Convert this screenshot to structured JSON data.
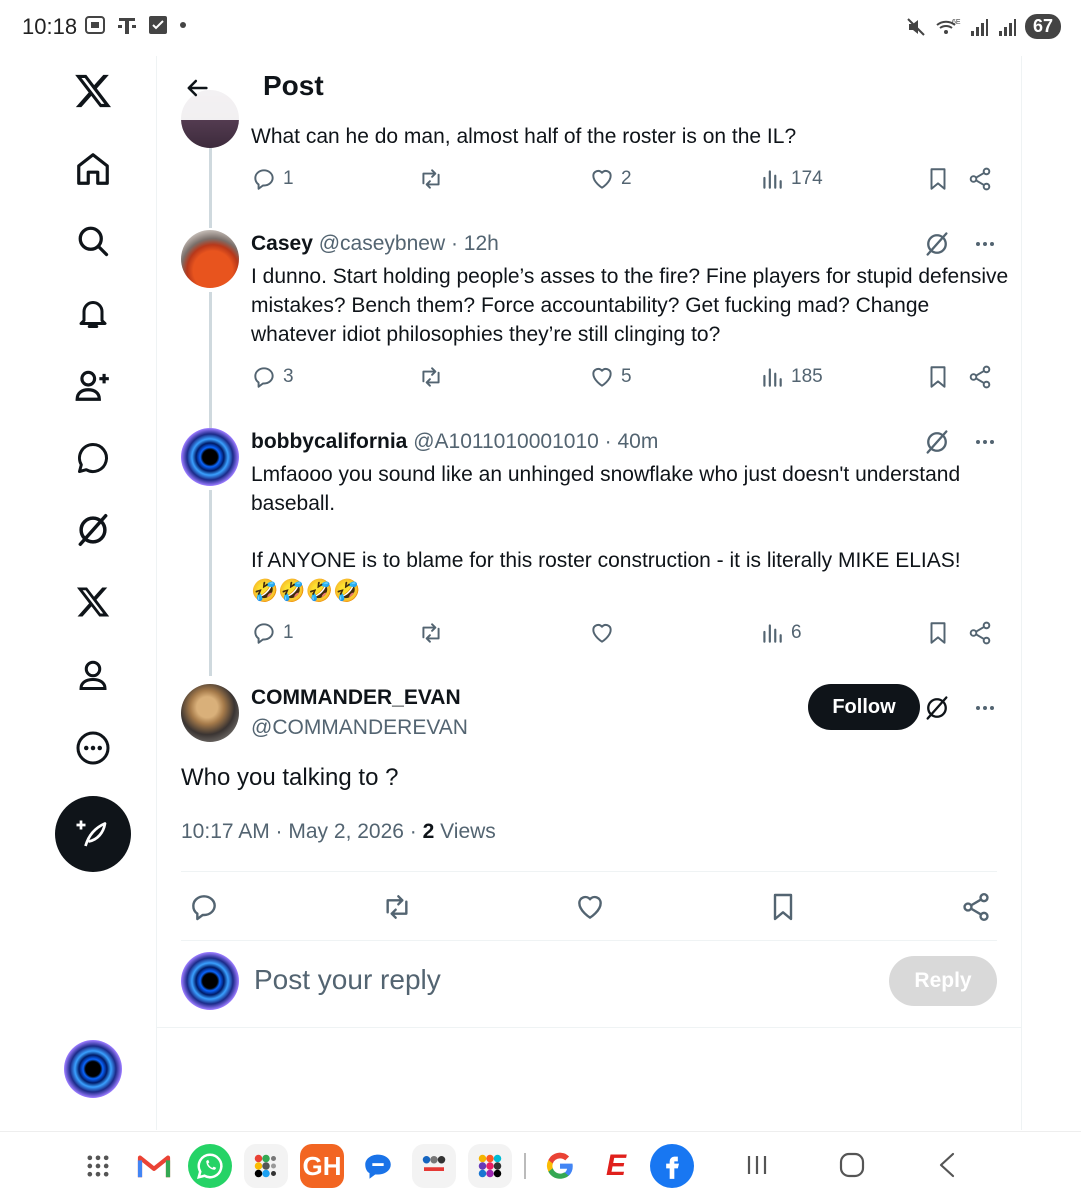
{
  "status_bar": {
    "time": "10:18",
    "battery": "67",
    "left_icons": [
      "screenshot-icon",
      "tmobile-icon",
      "checkbox-icon",
      "dot-icon"
    ],
    "right_icons": [
      "mute-icon",
      "wifi-6e-icon",
      "signal-icon",
      "signal-icon"
    ]
  },
  "sidebar": {
    "items": [
      "x-logo",
      "home",
      "search",
      "notifications",
      "follow",
      "chat",
      "grok",
      "premium",
      "profile",
      "more"
    ],
    "compose_label": "Post"
  },
  "header": {
    "title": "Post"
  },
  "thread": [
    {
      "text": "What can he do man, almost half of the roster is on the IL?",
      "replies": "1",
      "reposts": "",
      "likes": "2",
      "views": "174"
    },
    {
      "name": "Casey",
      "handle": "@caseybnew",
      "time": "· 12h",
      "text": "I dunno. Start holding people’s asses to the fire? Fine players for stupid defensive mistakes? Bench them? Force accountability? Get fucking mad? Change whatever idiot philosophies they’re still clinging to?",
      "replies": "3",
      "reposts": "",
      "likes": "5",
      "views": "185"
    },
    {
      "name": "bobbycalifornia",
      "handle": "@A1011010001010",
      "time": "· 40m",
      "text": "Lmfaooo you sound like an unhinged snowflake who just doesn't understand baseball.",
      "text2": "If ANYONE is to blame for this roster construction - it is literally MIKE ELIAS!",
      "emoji": "🤣🤣🤣🤣",
      "replies": "1",
      "reposts": "",
      "likes": "",
      "views": "6"
    }
  ],
  "main_tweet": {
    "name": "COMMANDER_EVAN",
    "handle": "@COMMANDEREVAN",
    "follow_label": "Follow",
    "text": "Who you talking to ?",
    "timestamp": "10:17 AM · May 2, 2026 · ",
    "views_count": "2",
    "views_label": " Views"
  },
  "reply_box": {
    "placeholder": "Post your reply",
    "button": "Reply"
  },
  "dock": {
    "apps": [
      "apps-grid",
      "gmail",
      "whatsapp",
      "folder-1",
      "gh",
      "messages",
      "folder-2",
      "folder-3",
      "google",
      "espn",
      "facebook"
    ],
    "gh_label": "GH",
    "espn_label": "E"
  },
  "colors": {
    "accent": "#1d9bf0",
    "text": "#0f1419",
    "muted": "#536471",
    "line": "#cfd9de"
  }
}
